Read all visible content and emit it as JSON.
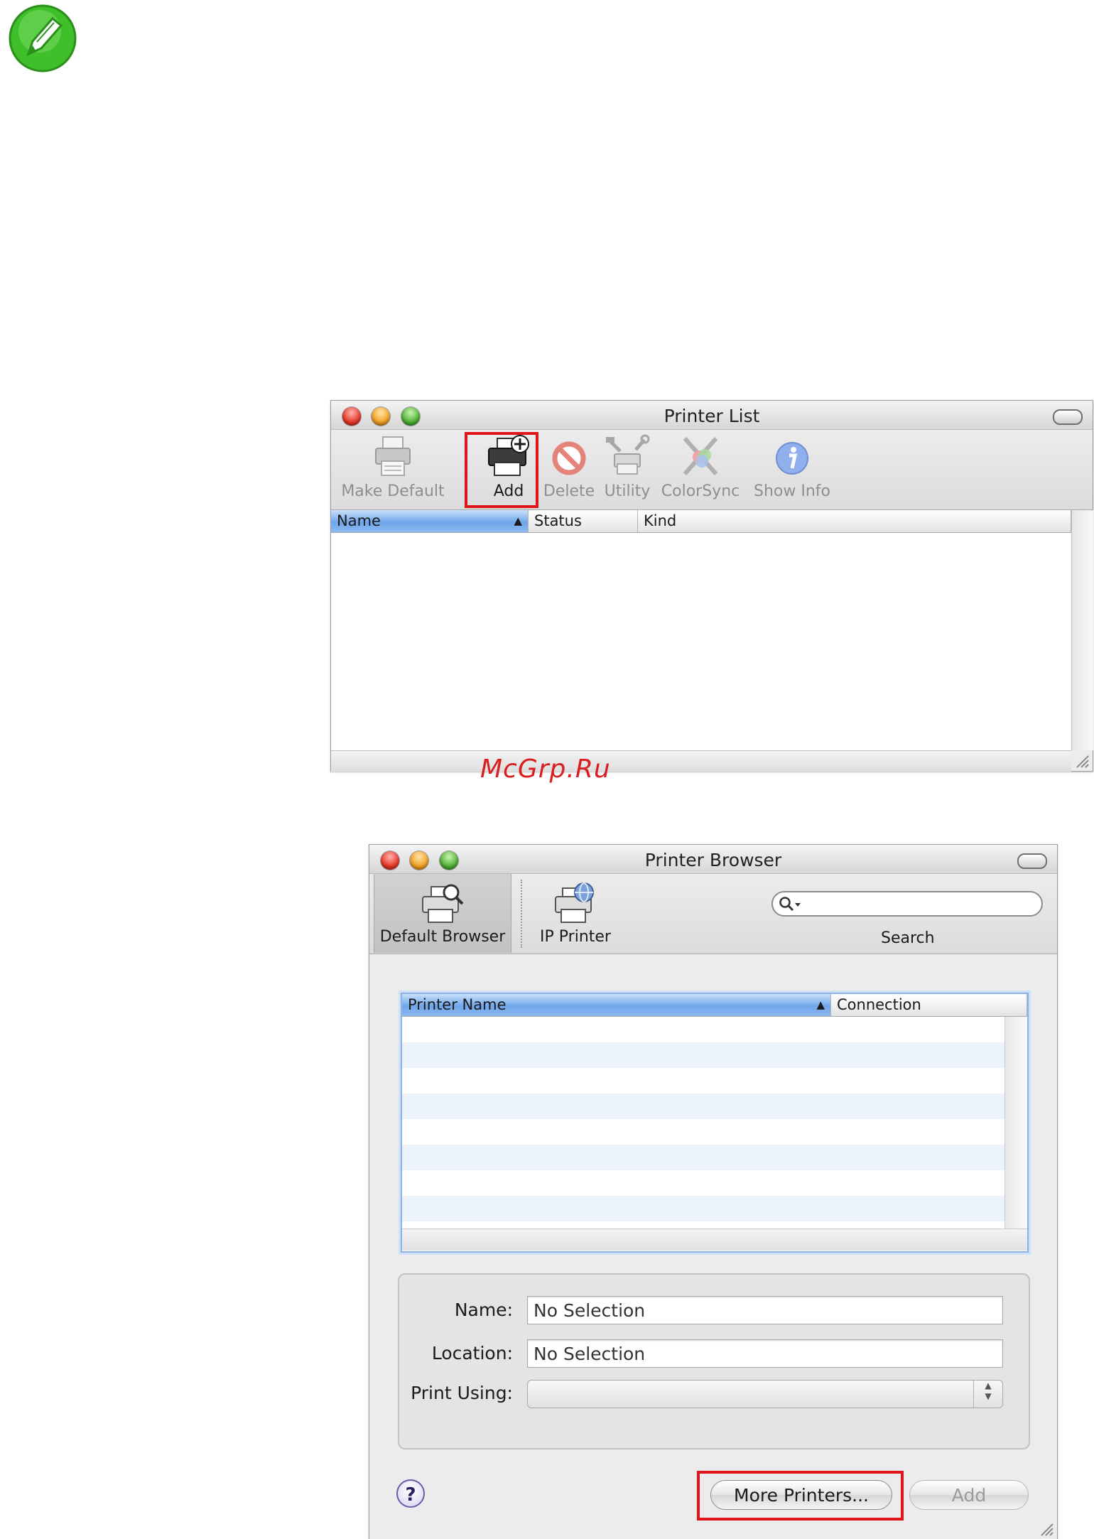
{
  "watermark": "McGrp.Ru",
  "printer_list": {
    "title": "Printer List",
    "toolbar": {
      "make_default": "Make Default",
      "add": "Add",
      "delete": "Delete",
      "utility": "Utility",
      "colorsync": "ColorSync",
      "show_info": "Show Info"
    },
    "columns": {
      "name": "Name",
      "status": "Status",
      "kind": "Kind"
    }
  },
  "printer_browser": {
    "title": "Printer Browser",
    "toolbar": {
      "default_browser": "Default Browser",
      "ip_printer": "IP Printer",
      "search_label": "Search",
      "search_value": ""
    },
    "columns": {
      "printer_name": "Printer Name",
      "connection": "Connection"
    },
    "form": {
      "name_label": "Name:",
      "name_value": "No Selection",
      "location_label": "Location:",
      "location_value": "No Selection",
      "print_using_label": "Print Using:",
      "print_using_value": ""
    },
    "buttons": {
      "help": "?",
      "more_printers": "More Printers...",
      "add": "Add"
    }
  },
  "colors": {
    "highlight_red": "#e1141b",
    "header_blue": "#6ea6ea",
    "note_green": "#3fbf2a"
  }
}
